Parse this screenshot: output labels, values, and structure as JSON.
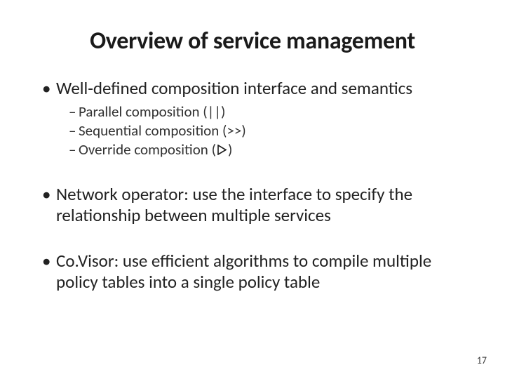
{
  "title": "Overview of service management",
  "bullets": {
    "b0": {
      "text": "Well-defined composition interface and semantics",
      "sub": {
        "s0": "Parallel composition (||)",
        "s1": "Sequential composition (>>)",
        "s2_pre": "Override composition (",
        "s2_post": ")"
      }
    },
    "b1": {
      "text": "Network operator: use the interface to specify the relationship between multiple services"
    },
    "b2": {
      "text": "Co.Visor: use efficient algorithms to compile multiple policy tables into a single policy table"
    }
  },
  "icons": {
    "override_symbol": "triangle-outline"
  },
  "page_number": "17"
}
